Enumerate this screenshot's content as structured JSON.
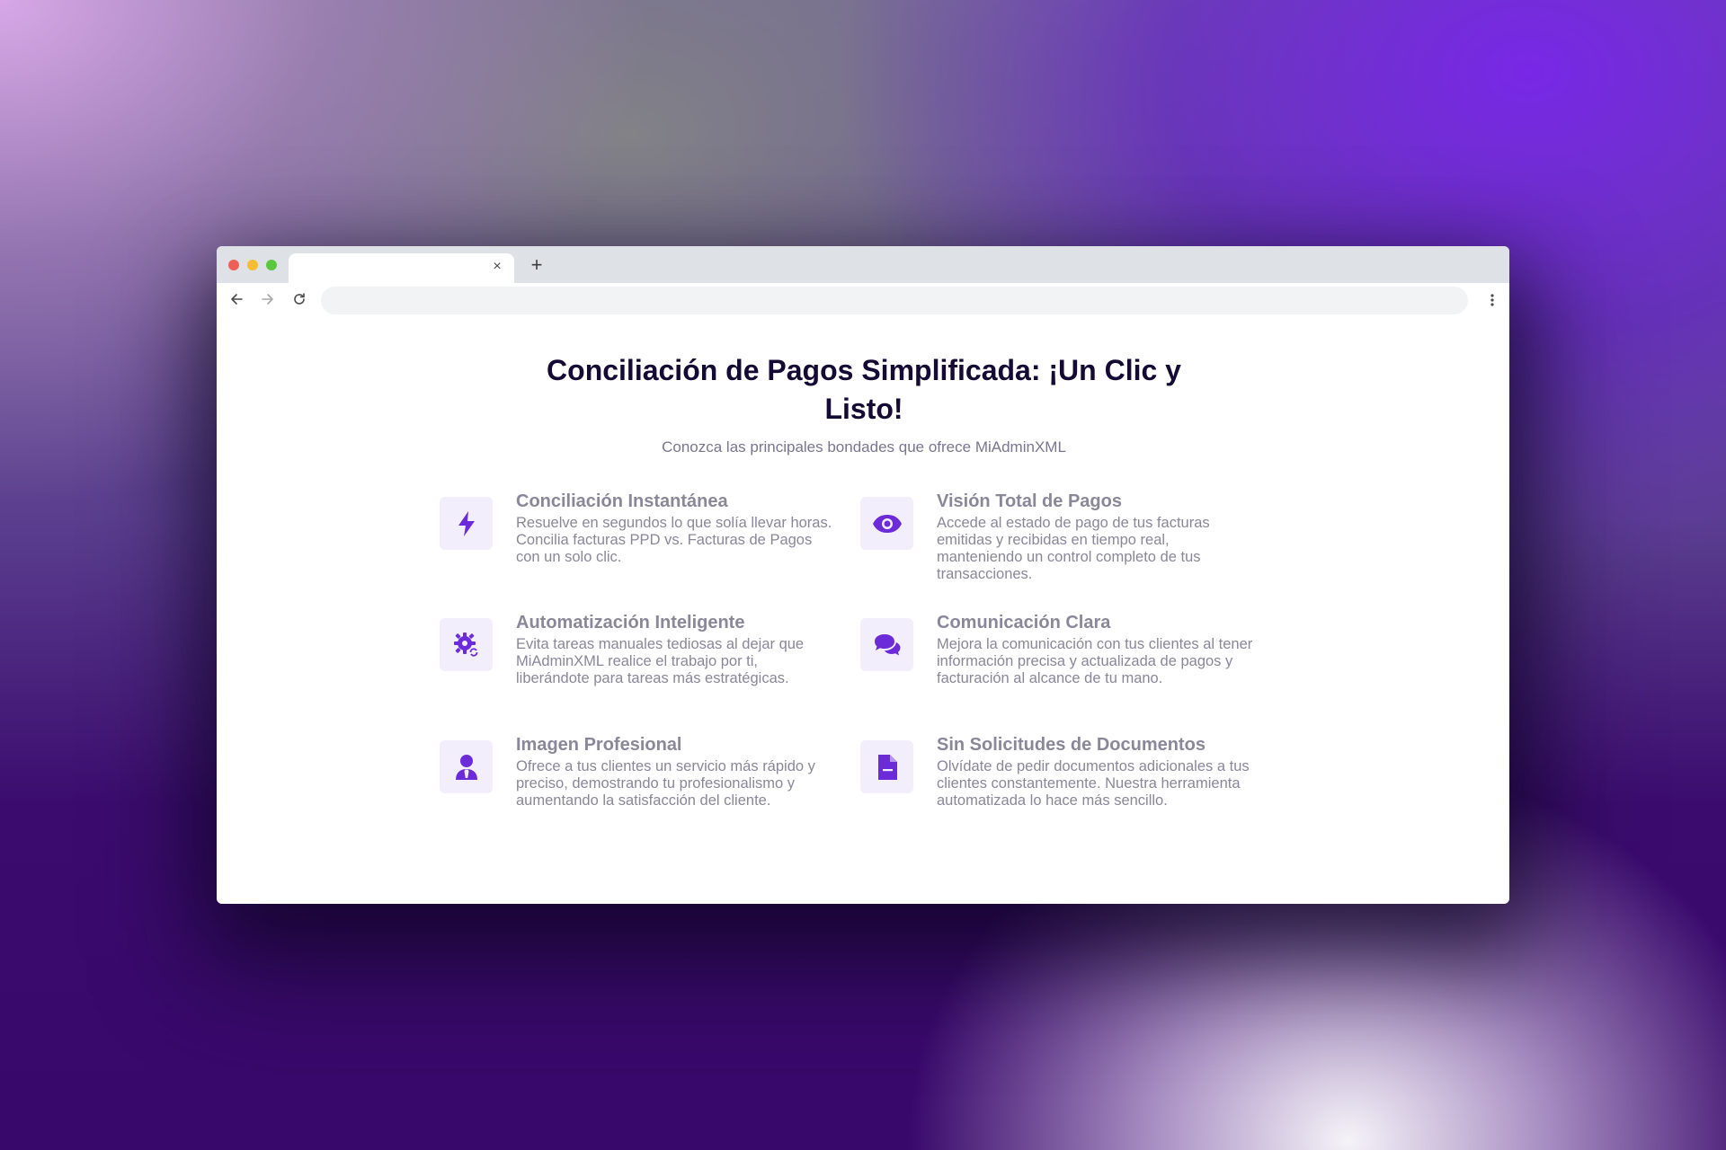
{
  "browser": {
    "tab_close": "×",
    "new_tab": "+"
  },
  "page": {
    "title": "Conciliación de Pagos Simplificada: ¡Un Clic y Listo!",
    "subtitle": "Conozca las principales bondades que ofrece MiAdminXML"
  },
  "features": [
    {
      "icon": "lightning-bolt-icon",
      "title": "Conciliación Instantánea",
      "description": "Resuelve en segundos lo que solía llevar horas. Concilia facturas PPD vs. Facturas de Pagos con un solo clic."
    },
    {
      "icon": "eye-icon",
      "title": "Visión Total de Pagos",
      "description": "Accede al estado de pago de tus facturas emitidas y recibidas en tiempo real, manteniendo un control completo de tus transacciones."
    },
    {
      "icon": "gear-sync-icon",
      "title": "Automatización Inteligente",
      "description": "Evita tareas manuales tediosas al dejar que MiAdminXML realice el trabajo por ti, liberándote para tareas más estratégicas."
    },
    {
      "icon": "chat-bubbles-icon",
      "title": "Comunicación Clara",
      "description": "Mejora la comunicación con tus clientes al tener información precisa y actualizada de pagos y facturación al alcance de tu mano."
    },
    {
      "icon": "user-tie-icon",
      "title": "Imagen Profesional",
      "description": "Ofrece a tus clientes un servicio más rápido y preciso, demostrando tu profesionalismo y aumentando la satisfacción del cliente."
    },
    {
      "icon": "document-icon",
      "title": "Sin Solicitudes de Documentos",
      "description": "Olvídate de pedir documentos adicionales a tus clientes constantemente. Nuestra herramienta automatizada lo hace más sencillo."
    }
  ],
  "colors": {
    "accent": "#6c2bd9",
    "icon_bg": "#f3eefb",
    "title": "#140a33",
    "muted_text": "#8a8799"
  }
}
